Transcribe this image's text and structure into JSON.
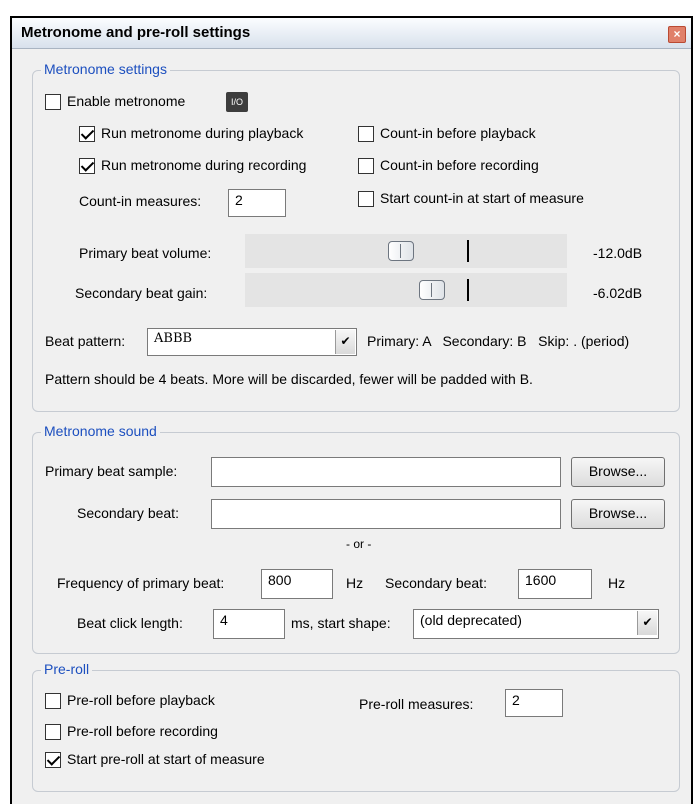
{
  "window": {
    "title": "Metronome and pre-roll settings",
    "close_glyph": "×"
  },
  "metronome_settings": {
    "label": "Metronome settings",
    "enable_label": "Enable metronome",
    "enable_checked": false,
    "io_label": "I/O",
    "run_playback_label": "Run metronome during playback",
    "run_playback_checked": true,
    "run_recording_label": "Run metronome during recording",
    "run_recording_checked": true,
    "countin_playback_label": "Count-in before playback",
    "countin_playback_checked": false,
    "countin_recording_label": "Count-in before recording",
    "countin_recording_checked": false,
    "countin_measures_label": "Count-in measures:",
    "countin_measures_value": "2",
    "start_countin_label": "Start count-in at start of measure",
    "start_countin_checked": false,
    "primary_volume_label": "Primary beat volume:",
    "primary_volume_value": "-12.0dB",
    "secondary_gain_label": "Secondary beat gain:",
    "secondary_gain_value": "-6.02dB",
    "beat_pattern_label": "Beat pattern:",
    "beat_pattern_value": "ABBB",
    "pattern_legend": "Primary: A   Secondary: B   Skip: . (period)",
    "pattern_note": "Pattern should be 4 beats. More will be discarded, fewer will be padded with B."
  },
  "metronome_sound": {
    "label": "Metronome sound",
    "primary_sample_label": "Primary beat sample:",
    "primary_sample_value": "",
    "secondary_beat_label": "Secondary beat:",
    "secondary_beat_value": "",
    "browse_label": "Browse...",
    "or_label": "- or -",
    "freq_primary_label": "Frequency of primary beat:",
    "freq_primary_value": "800",
    "hz_label": "Hz",
    "secondary_freq_label": "Secondary beat:",
    "secondary_freq_value": "1600",
    "click_length_label": "Beat click length:",
    "click_length_value": "4",
    "start_shape_label": "ms, start shape:",
    "start_shape_value": "(old deprecated)"
  },
  "preroll": {
    "label": "Pre-roll",
    "before_playback_label": "Pre-roll before playback",
    "before_playback_checked": false,
    "before_recording_label": "Pre-roll before recording",
    "before_recording_checked": false,
    "start_measure_label": "Start pre-roll at start of measure",
    "start_measure_checked": true,
    "measures_label": "Pre-roll measures:",
    "measures_value": "2"
  }
}
